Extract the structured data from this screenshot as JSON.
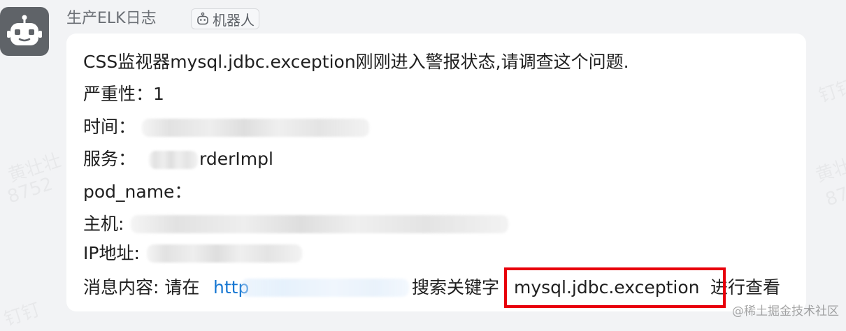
{
  "message": {
    "sender_name": "生产ELK日志",
    "bot_tag_label": "机器人",
    "line1": "CSS监视器mysql.jdbc.exception刚刚进入警报状态,请调查这个问题.",
    "severity_label": "严重性：",
    "severity_value": "1",
    "time_label": "时间：",
    "service_label": "服务：",
    "service_value_visible": "rderImpl",
    "pod_name_label": "pod_name：",
    "host_label": "主机:",
    "ip_label": "IP地址:",
    "content_label": "消息内容: 请在",
    "content_link_visible": "http",
    "content_middle": "搜索关键字",
    "content_keyword": "mysql.jdbc.exception",
    "content_end": "进行查看"
  },
  "watermark": {
    "text_a": "黄壮壮",
    "text_b": "8752",
    "text_c": "钉钉"
  },
  "footer": {
    "source_mark": "@稀土掘金技术社区"
  },
  "colors": {
    "background": "#f2f3f5",
    "bubble": "#ffffff",
    "link": "#1677d2",
    "highlight_border": "#e8000b",
    "avatar_bg": "#5f6368"
  }
}
